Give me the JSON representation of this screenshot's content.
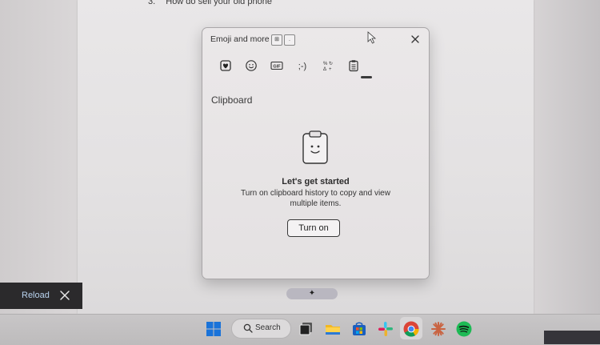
{
  "document": {
    "line_number": "3.",
    "line_text": "How do sell your old phone"
  },
  "panel": {
    "title": "Emoji and more",
    "key_badges": [
      "⊞",
      "."
    ],
    "tabs": [
      {
        "name": "tab-kaomoji-heart",
        "icon": "heart-sticker-icon"
      },
      {
        "name": "tab-emoji",
        "icon": "smiley-icon"
      },
      {
        "name": "tab-gif",
        "icon": "gif-icon",
        "label": "GIF"
      },
      {
        "name": "tab-kaomoji",
        "icon": "kaomoji-icon",
        "label": ";-)"
      },
      {
        "name": "tab-symbols",
        "icon": "symbols-icon"
      },
      {
        "name": "tab-clipboard",
        "icon": "clipboard-icon",
        "selected": true
      }
    ],
    "section_label": "Clipboard",
    "empty_state": {
      "title": "Let's get started",
      "description": "Turn on clipboard history to copy and view multiple items.",
      "button_label": "Turn on"
    }
  },
  "sparkle_pill": {
    "label": "✦"
  },
  "toast": {
    "action_label": "Reload"
  },
  "taskbar": {
    "search_label": "Search",
    "apps": [
      "windows-start",
      "search",
      "task-view",
      "file-explorer",
      "microsoft-store",
      "slack",
      "chrome",
      "claude",
      "spotify"
    ]
  }
}
